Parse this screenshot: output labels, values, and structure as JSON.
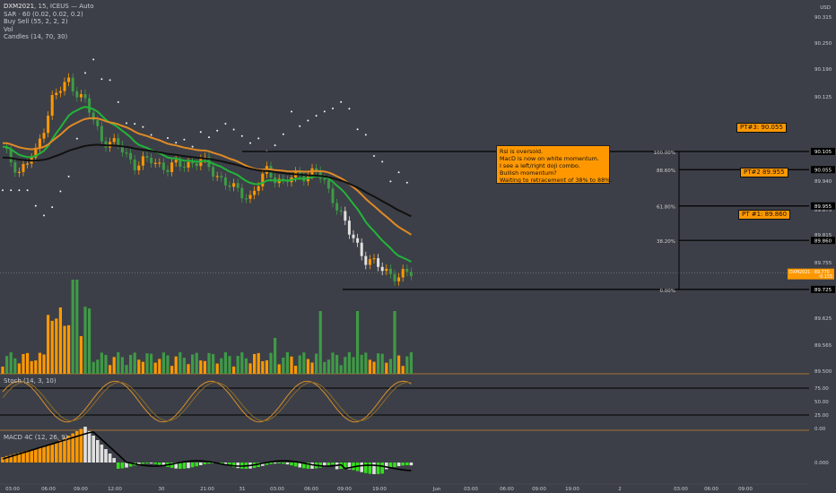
{
  "legend": {
    "symbol": "DXM2021",
    "interval": "15",
    "exchange": "ICEUS",
    "rest": "— Auto",
    "lines": [
      "SAR · 60 (0.02, 0.02, 0.2)",
      "Buy Sell (55, 2, 2, 2)",
      "Vol",
      "Candles (14, 70, 30)"
    ]
  },
  "currency": "USD",
  "colors": {
    "background": "#3c3f47",
    "up": "#ff9800",
    "down": "#3f9a47",
    "white_bar": "#e0e0e0",
    "lime_bar": "#33e01a",
    "green_line": "#22b43a",
    "orange_line": "#e08a26",
    "black_line": "#111111",
    "label_orange": "#ff9800"
  },
  "annotation": {
    "lines": [
      "Rsi is oversold.",
      "MacD is now on white momentum.",
      "I see a left/right doji combo.",
      "Bullish momentum?",
      "Waiting to retracement of 38% to 88%."
    ]
  },
  "price_targets": [
    {
      "label": "PT#3: 90.055",
      "price": 90.055
    },
    {
      "label": "PT#2 89.955",
      "price": 89.955
    },
    {
      "label": "PT #1: 89.860",
      "price": 89.86
    }
  ],
  "fib_levels": [
    {
      "label": "100.00%",
      "price": 90.105
    },
    {
      "label": "88.60%",
      "price": 90.055
    },
    {
      "label": "61.80%",
      "price": 89.955
    },
    {
      "label": "38.20%",
      "price": 89.86
    },
    {
      "label": "0.00%",
      "price": 89.725
    }
  ],
  "last_price": {
    "label": "DXM2021",
    "value": "89.770",
    "change": "-0.155"
  },
  "stoch_label": "Stoch (14, 3, 10)",
  "macd_label": "MACD 4C (12, 26, 9)",
  "chart_data": [
    {
      "type": "candlestick",
      "title": "DXM2021, 15, ICEUS",
      "price_axis": {
        "ticks": [
          "90.315",
          "90.250",
          "90.190",
          "90.125",
          "90.105",
          "90.055",
          "89.955",
          "89.940",
          "89.875",
          "89.860",
          "89.815",
          "89.770",
          "89.755",
          "89.725",
          "89.690",
          "89.625",
          "89.565",
          "89.500"
        ],
        "ylim": [
          89.5,
          90.33
        ]
      },
      "x_ticks": [
        "03:00",
        "06:00",
        "09:00",
        "12:00",
        "30",
        "21:00",
        "31",
        "03:00",
        "06:00",
        "09:00",
        "19:00",
        "Jun",
        "03:00",
        "06:00",
        "09:00",
        "19:00",
        "2",
        "03:00",
        "06:00",
        "09:00"
      ],
      "close_points": [
        [
          0,
          90.11
        ],
        [
          4,
          90.05
        ],
        [
          8,
          90.1
        ],
        [
          12,
          90.25
        ],
        [
          16,
          90.3
        ],
        [
          20,
          90.24
        ],
        [
          24,
          90.14
        ],
        [
          28,
          90.12
        ],
        [
          32,
          90.07
        ],
        [
          36,
          90.08
        ],
        [
          40,
          90.06
        ],
        [
          44,
          90.07
        ],
        [
          48,
          90.08
        ],
        [
          52,
          90.04
        ],
        [
          56,
          90.0
        ],
        [
          60,
          89.98
        ],
        [
          64,
          90.05
        ],
        [
          68,
          90.02
        ],
        [
          72,
          90.04
        ],
        [
          76,
          90.05
        ],
        [
          80,
          89.98
        ],
        [
          84,
          89.88
        ],
        [
          88,
          89.81
        ],
        [
          92,
          89.78
        ],
        [
          96,
          89.76
        ],
        [
          99,
          89.77
        ]
      ],
      "volume_note": "volume histogram shown in lower part of price pane (orange up, green down)"
    },
    {
      "type": "line",
      "title": "Stoch (14, 3, 10)",
      "ylim": [
        0,
        100
      ],
      "levels": [
        75,
        25
      ],
      "axis_ticks": [
        "75.00",
        "50.00",
        "25.00",
        "0.00"
      ]
    },
    {
      "type": "bar",
      "title": "MACD 4C (12, 26, 9)",
      "axis_ticks": [
        "0.000"
      ]
    }
  ]
}
